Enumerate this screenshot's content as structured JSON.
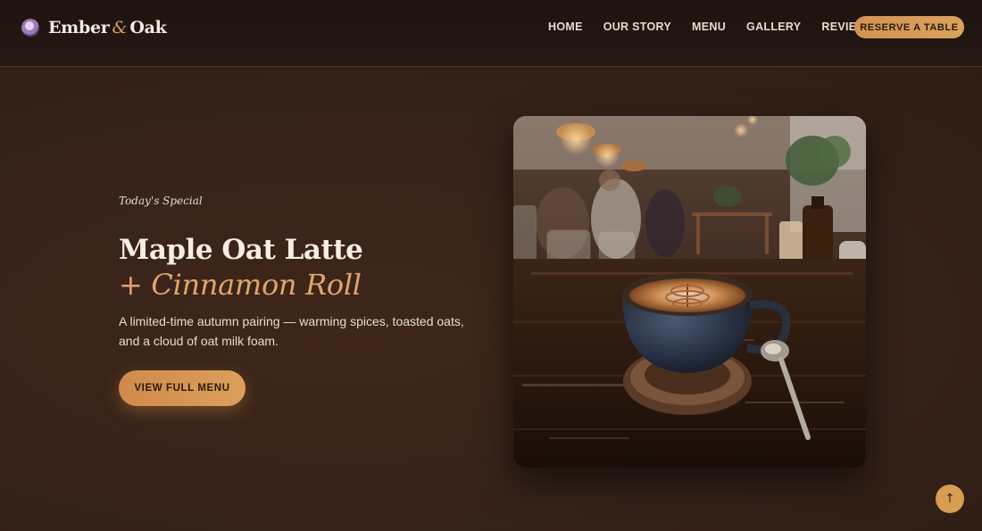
{
  "header": {
    "brand_word1": "Ember",
    "brand_amp": "&",
    "brand_word2": "Oak",
    "nav": [
      "HOME",
      "OUR STORY",
      "MENU",
      "GALLERY",
      "REVIEWS"
    ],
    "reserve_label": "RESERVE A TABLE"
  },
  "hero": {
    "eyebrow": "Today's Special",
    "title_line1": "Maple Oat Latte",
    "title_line2": "+ Cinnamon Roll",
    "description": "A limited-time autumn pairing — warming spices, toasted oats, and a cloud of oat milk foam.",
    "cta_label": "VIEW FULL MENU"
  },
  "scroll_top_icon": "↑",
  "colors": {
    "accent": "#d99a5b",
    "background": "#3a2417",
    "header": "#1d1410"
  }
}
